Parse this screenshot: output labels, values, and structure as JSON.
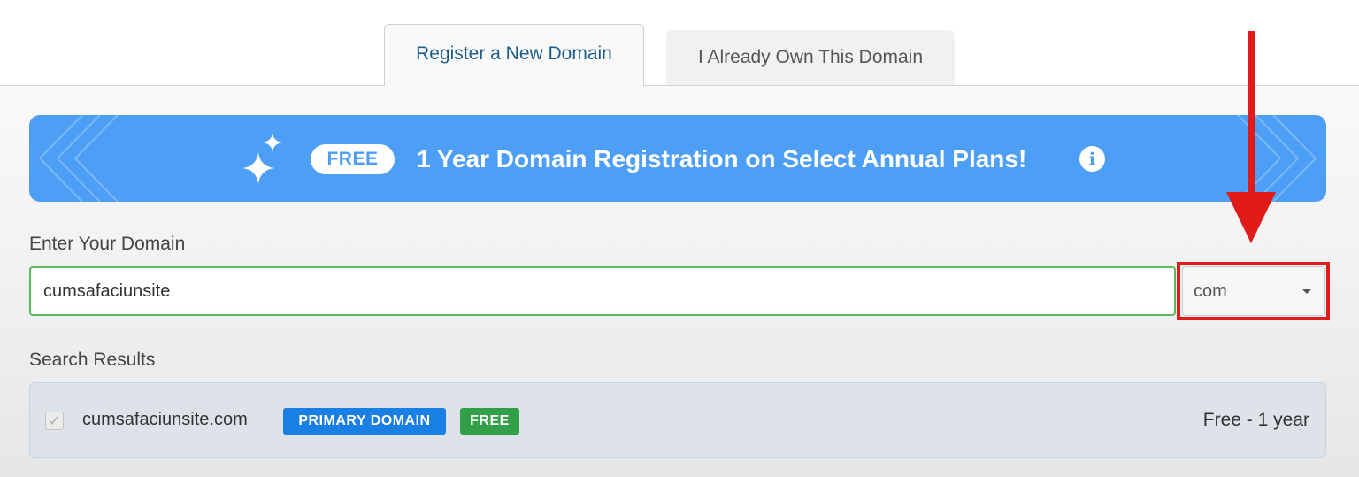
{
  "tabs": [
    {
      "label": "Register a New Domain",
      "active": true
    },
    {
      "label": "I Already Own This Domain",
      "active": false
    }
  ],
  "banner": {
    "badge": "FREE",
    "text": "1 Year Domain Registration on Select Annual Plans!",
    "info_icon": "info-icon",
    "sparkle_icon": "sparkle-icon",
    "color": "#4d9ff6"
  },
  "domain_form": {
    "label": "Enter Your Domain",
    "value": "cumsafaciunsite",
    "tld": "com"
  },
  "results": {
    "label": "Search Results",
    "items": [
      {
        "domain": "cumsafaciunsite.com",
        "badges": [
          "PRIMARY DOMAIN",
          "FREE"
        ],
        "price": "Free - 1 year",
        "checked": true
      }
    ]
  },
  "colors": {
    "primary_badge": "#1a7fe3",
    "free_badge": "#31a048",
    "input_border": "#5cb85c",
    "annotation": "#e11a1a"
  }
}
